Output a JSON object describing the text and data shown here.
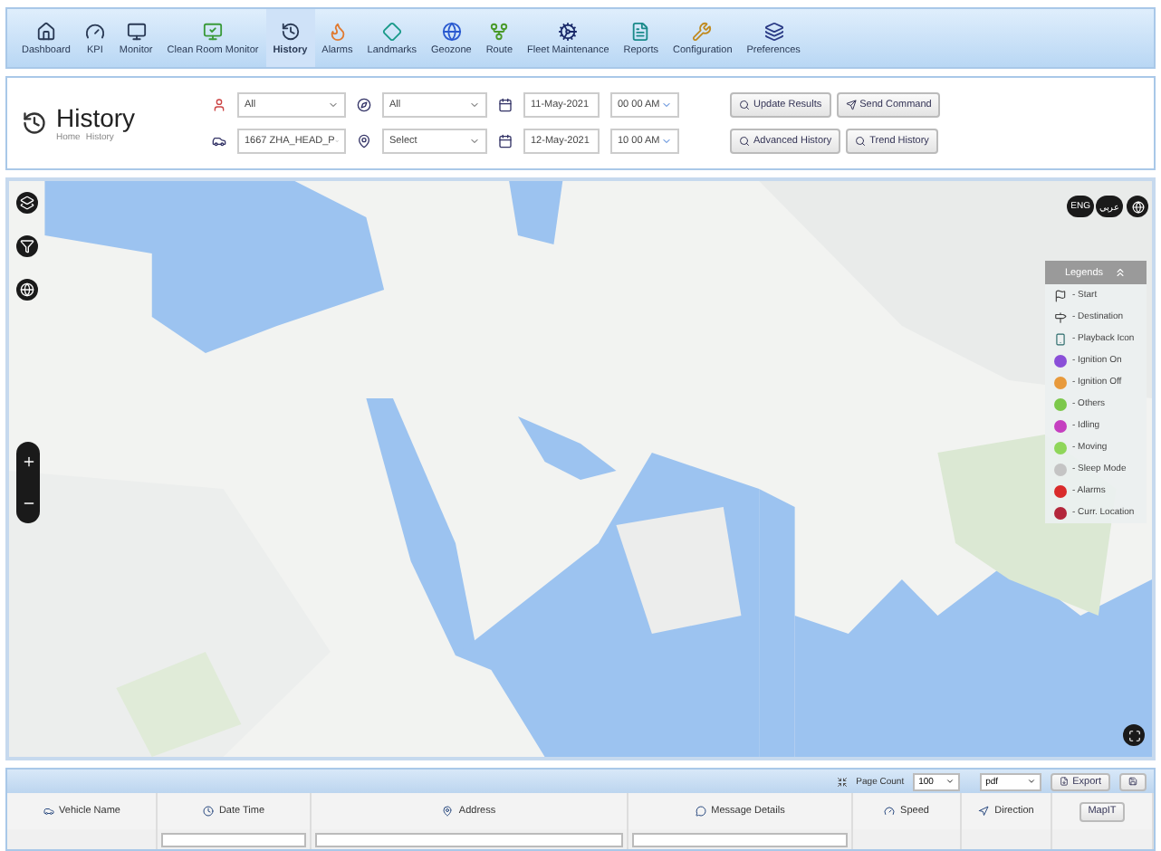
{
  "nav": [
    {
      "label": "Dashboard",
      "selected": false
    },
    {
      "label": "KPI",
      "selected": false
    },
    {
      "label": "Monitor",
      "selected": false
    },
    {
      "label": "Clean Room Monitor",
      "selected": false
    },
    {
      "label": "History",
      "selected": true
    },
    {
      "label": "Alarms",
      "selected": false
    },
    {
      "label": "Landmarks",
      "selected": false
    },
    {
      "label": "Geozone",
      "selected": false
    },
    {
      "label": "Route",
      "selected": false
    },
    {
      "label": "Fleet Maintenance",
      "selected": false
    },
    {
      "label": "Reports",
      "selected": false
    },
    {
      "label": "Configuration",
      "selected": false
    },
    {
      "label": "Preferences",
      "selected": false
    }
  ],
  "page": {
    "title": "History",
    "breadcrumb": [
      "Home",
      "History"
    ]
  },
  "filters": {
    "row_1": {
      "select_a": "All",
      "select_b": "All",
      "date": "11-May-2021",
      "time": "00 00 AM"
    },
    "row_2": {
      "select_a": "1667 ZHA_HEAD_P",
      "select_b": "Select",
      "date": "12-May-2021",
      "time": "10 00 AM"
    }
  },
  "actions": [
    [
      "Update Results",
      "Send Command"
    ],
    [
      "Advanced History",
      "Trend History"
    ]
  ],
  "map": {
    "languages": [
      "ENG",
      "عربي"
    ],
    "legend": {
      "title": "Legends",
      "items": [
        {
          "kind": "flag",
          "label": "- Start"
        },
        {
          "kind": "finish",
          "label": "- Destination"
        },
        {
          "kind": "playback",
          "label": "- Playback Icon"
        },
        {
          "kind": "dot",
          "label": "- Ignition On",
          "color": "#8a4fd8"
        },
        {
          "kind": "dot",
          "label": "- Ignition Off",
          "color": "#e89a3c"
        },
        {
          "kind": "dot",
          "label": "- Others",
          "color": "#7cc84a"
        },
        {
          "kind": "dot",
          "label": "- Idling",
          "color": "#c53fc0"
        },
        {
          "kind": "dot",
          "label": "- Moving",
          "color": "#8fd65a"
        },
        {
          "kind": "dot",
          "label": "- Sleep Mode",
          "color": "#c4c4c4"
        },
        {
          "kind": "dot",
          "label": "- Alarms",
          "color": "#d92b2b"
        },
        {
          "kind": "dot",
          "label": "- Curr. Location",
          "color": "#b3263b"
        }
      ]
    }
  },
  "grid": {
    "page_count_label": "Page Count",
    "page_count": "100",
    "format": "pdf",
    "export": "Export",
    "columns": [
      "Vehicle Name",
      "Date Time",
      "Address",
      "Message Details",
      "Speed",
      "Direction"
    ],
    "map_button": "MapIT"
  }
}
